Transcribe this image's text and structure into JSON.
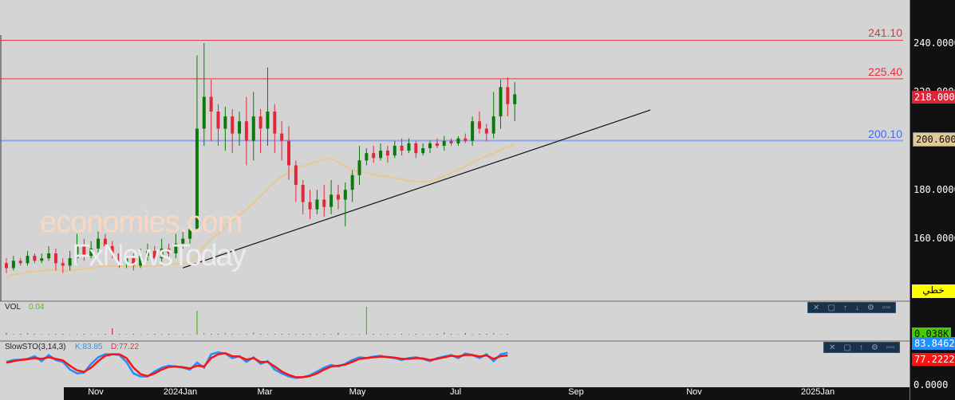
{
  "price_levels": [
    {
      "label": "241.10",
      "value": 241.1,
      "color": "#e8303c"
    },
    {
      "label": "225.40",
      "value": 225.4,
      "color": "#e8303c"
    },
    {
      "label": "200.10",
      "value": 200.1,
      "color": "#4466ff"
    }
  ],
  "y_axis": {
    "ticks": [
      "240.0000",
      "220.0000",
      "180.0000",
      "160.0000"
    ],
    "tick_values": [
      240,
      220,
      180,
      160
    ],
    "last_price": "218.0000",
    "ma_value": "200.6000",
    "chart_type_btn": "خطي"
  },
  "time_axis": {
    "labels": [
      "Nov",
      "2024Jan",
      "Mar",
      "May",
      "Jul",
      "Sep",
      "Nov",
      "2025Jan"
    ]
  },
  "volume": {
    "title": "VOL",
    "value": "0.04",
    "axis_label": "0.038K",
    "values": [
      2,
      1,
      1,
      2,
      1,
      1,
      1,
      1,
      1,
      1,
      1,
      1,
      1,
      1,
      1,
      8,
      1,
      1,
      1,
      1,
      1,
      1,
      1,
      1,
      1,
      1,
      1,
      30,
      2,
      1,
      1,
      2,
      1,
      1,
      1,
      3,
      1,
      1,
      1,
      1,
      1,
      1,
      1,
      1,
      1,
      1,
      1,
      2,
      1,
      1,
      1,
      35,
      1,
      1,
      1,
      1,
      1,
      1,
      1,
      1,
      1,
      1,
      3,
      1,
      1,
      2,
      1,
      1,
      1,
      2,
      1,
      1
    ]
  },
  "stochastic": {
    "title": "SlowSTO(3,14,3)",
    "k_label": "K:83.85",
    "d_label": "D:77.22",
    "k_tag": "83.8462",
    "d_tag": "77.2222",
    "zero": "0.0000",
    "k": [
      60,
      65,
      66,
      68,
      75,
      62,
      78,
      65,
      60,
      40,
      30,
      32,
      55,
      72,
      80,
      80,
      78,
      60,
      30,
      22,
      22,
      35,
      45,
      50,
      48,
      45,
      40,
      58,
      45,
      80,
      85,
      82,
      70,
      75,
      60,
      72,
      55,
      62,
      40,
      30,
      22,
      18,
      20,
      25,
      35,
      45,
      52,
      48,
      55,
      65,
      72,
      70,
      74,
      76,
      72,
      70,
      65,
      70,
      72,
      68,
      62,
      70,
      74,
      78,
      70,
      82,
      78,
      70,
      80,
      62,
      80,
      84
    ],
    "d": [
      58,
      62,
      65,
      67,
      70,
      68,
      72,
      68,
      64,
      50,
      38,
      34,
      45,
      62,
      76,
      80,
      80,
      70,
      45,
      28,
      23,
      30,
      40,
      47,
      48,
      46,
      43,
      50,
      48,
      70,
      80,
      83,
      75,
      74,
      66,
      70,
      60,
      60,
      48,
      35,
      26,
      20,
      20,
      23,
      30,
      40,
      48,
      50,
      53,
      60,
      68,
      70,
      72,
      74,
      73,
      71,
      68,
      68,
      70,
      69,
      65,
      68,
      72,
      76,
      74,
      78,
      78,
      74,
      77,
      68,
      75,
      77
    ]
  },
  "watermark": {
    "line1": "economies.com",
    "line2": "FxNewsToday"
  },
  "chart_data": {
    "type": "candlestick",
    "title": "",
    "ylim": [
      134.5,
      258
    ],
    "candles_ocHL": [
      [
        150,
        148,
        152,
        146
      ],
      [
        148,
        151,
        153,
        147
      ],
      [
        151,
        150,
        152,
        149
      ],
      [
        150,
        153,
        155,
        149
      ],
      [
        153,
        151,
        154,
        150
      ],
      [
        151,
        152,
        154,
        150
      ],
      [
        152,
        154,
        157,
        151
      ],
      [
        154,
        150,
        156,
        147
      ],
      [
        150,
        149,
        152,
        146
      ],
      [
        149,
        152,
        155,
        147
      ],
      [
        152,
        157,
        162,
        150
      ],
      [
        157,
        153,
        160,
        151
      ],
      [
        153,
        156,
        159,
        152
      ],
      [
        156,
        160,
        163,
        154
      ],
      [
        160,
        157,
        162,
        155
      ],
      [
        157,
        154,
        159,
        152
      ],
      [
        154,
        150,
        157,
        148
      ],
      [
        150,
        152,
        155,
        148
      ],
      [
        152,
        149,
        154,
        147
      ],
      [
        149,
        153,
        156,
        148
      ],
      [
        153,
        155,
        158,
        151
      ],
      [
        155,
        152,
        157,
        150
      ],
      [
        152,
        156,
        160,
        149
      ],
      [
        156,
        154,
        158,
        152
      ],
      [
        154,
        158,
        162,
        152
      ],
      [
        158,
        160,
        164,
        156
      ],
      [
        160,
        164,
        168,
        158
      ],
      [
        164,
        205,
        235,
        180
      ],
      [
        205,
        218,
        240,
        198
      ],
      [
        218,
        212,
        225,
        200
      ],
      [
        212,
        205,
        215,
        198
      ],
      [
        205,
        210,
        214,
        196
      ],
      [
        210,
        203,
        213,
        195
      ],
      [
        203,
        208,
        212,
        198
      ],
      [
        208,
        200,
        218,
        190
      ],
      [
        200,
        210,
        220,
        192
      ],
      [
        210,
        205,
        213,
        195
      ],
      [
        205,
        212,
        230,
        198
      ],
      [
        212,
        203,
        215,
        195
      ],
      [
        203,
        200,
        208,
        192
      ],
      [
        200,
        190,
        206,
        184
      ],
      [
        190,
        182,
        192,
        175
      ],
      [
        182,
        175,
        184,
        170
      ],
      [
        175,
        172,
        180,
        168
      ],
      [
        172,
        176,
        180,
        170
      ],
      [
        176,
        173,
        182,
        169
      ],
      [
        173,
        178,
        184,
        170
      ],
      [
        178,
        176,
        182,
        172
      ],
      [
        176,
        180,
        183,
        165
      ],
      [
        180,
        186,
        188,
        175
      ],
      [
        186,
        192,
        198,
        182
      ],
      [
        192,
        195,
        197,
        190
      ],
      [
        195,
        193,
        198,
        191
      ],
      [
        193,
        196,
        199,
        192
      ],
      [
        196,
        194,
        198,
        191
      ],
      [
        194,
        198,
        200,
        193
      ],
      [
        198,
        196,
        201,
        194
      ],
      [
        196,
        199,
        201,
        195
      ],
      [
        199,
        195,
        200,
        193
      ],
      [
        195,
        197,
        199,
        194
      ],
      [
        197,
        199,
        200,
        195
      ],
      [
        199,
        198,
        201,
        197
      ],
      [
        198,
        200,
        202,
        196
      ],
      [
        200,
        199,
        201,
        198
      ],
      [
        199,
        201,
        202,
        198
      ],
      [
        201,
        200,
        203,
        199
      ],
      [
        200,
        208,
        210,
        198
      ],
      [
        208,
        205,
        212,
        203
      ],
      [
        205,
        203,
        207,
        200
      ],
      [
        203,
        210,
        220,
        201
      ],
      [
        210,
        222,
        225,
        205
      ],
      [
        222,
        215,
        226,
        210
      ],
      [
        215,
        219,
        224,
        208
      ]
    ],
    "ma_period": 20,
    "trendline": {
      "from": [
        25,
        148.1
      ],
      "to": [
        91.2,
        212.6
      ]
    },
    "colors": {
      "up": "#0a7a0a",
      "down": "#e0283a",
      "ma": "#e8c890",
      "trend": "#111111"
    }
  }
}
